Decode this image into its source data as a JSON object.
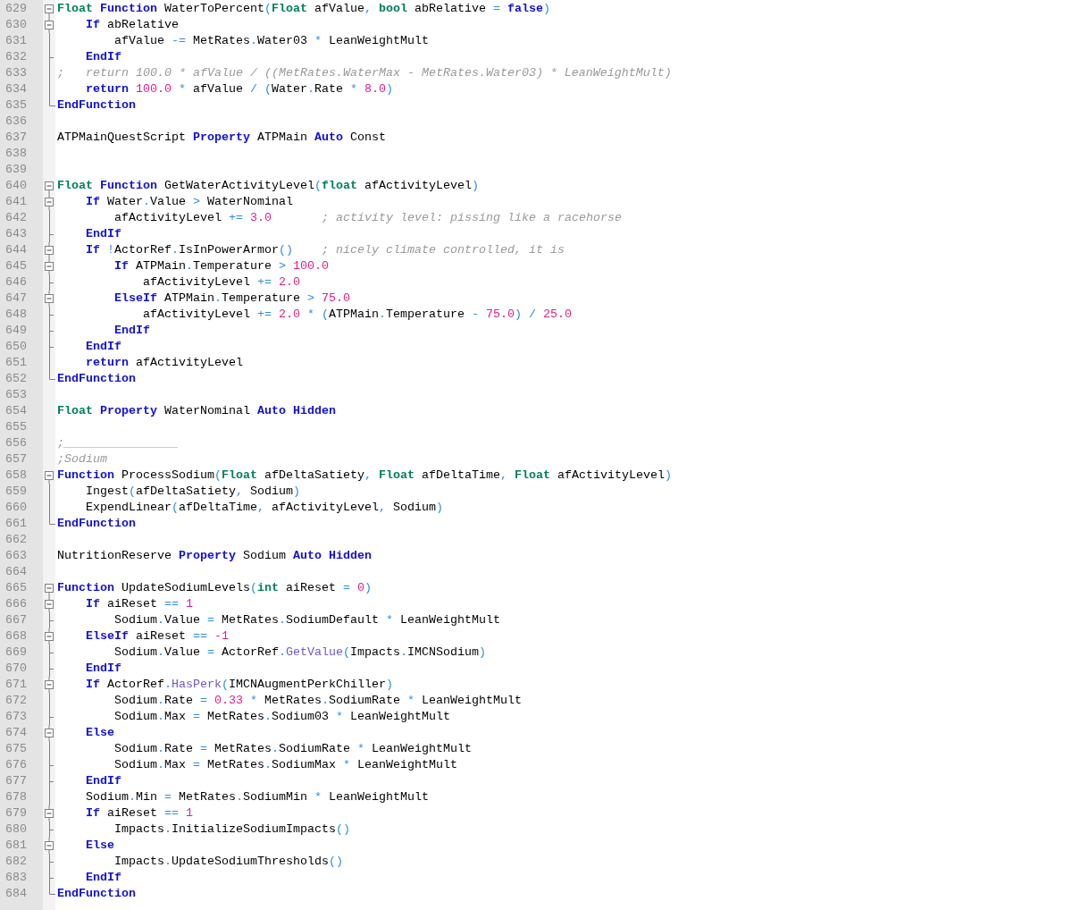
{
  "editor": {
    "lines": [
      {
        "number": "629",
        "fold": {
          "kind": "toggle"
        },
        "tokens": [
          {
            "kind": "type",
            "text": "Float"
          },
          {
            "kind": "keyword",
            "text": " Function"
          },
          {
            "kind": "plain",
            "text": " WaterToPercent"
          },
          {
            "kind": "operator",
            "text": "("
          },
          {
            "kind": "type",
            "text": "Float"
          },
          {
            "kind": "plain",
            "text": " afValue"
          },
          {
            "kind": "operator",
            "text": ","
          },
          {
            "kind": "type",
            "text": " bool"
          },
          {
            "kind": "plain",
            "text": " abRelative"
          },
          {
            "kind": "operator",
            "text": " ="
          },
          {
            "kind": "keyword",
            "text": " false"
          },
          {
            "kind": "operator",
            "text": ")"
          }
        ]
      },
      {
        "number": "630",
        "fold": {
          "kind": "inner-toggle"
        },
        "tokens": [
          {
            "kind": "keyword",
            "text": "    If"
          },
          {
            "kind": "plain",
            "text": " abRelative"
          }
        ]
      },
      {
        "number": "631",
        "fold": {
          "kind": "line"
        },
        "tokens": [
          {
            "kind": "plain",
            "text": "        afValue"
          },
          {
            "kind": "operator",
            "text": " -="
          },
          {
            "kind": "plain",
            "text": " MetRates"
          },
          {
            "kind": "operator",
            "text": "."
          },
          {
            "kind": "plain",
            "text": "Water03"
          },
          {
            "kind": "operator",
            "text": " *"
          },
          {
            "kind": "plain",
            "text": " LeanWeightMult"
          }
        ]
      },
      {
        "number": "632",
        "fold": {
          "kind": "tick"
        },
        "tokens": [
          {
            "kind": "keyword",
            "text": "    EndIf"
          }
        ]
      },
      {
        "number": "633",
        "fold": {
          "kind": "line"
        },
        "tokens": [
          {
            "kind": "comment",
            "text": ";   return 100.0 * afValue / ((MetRates.WaterMax - MetRates.Water03) * LeanWeightMult)"
          }
        ]
      },
      {
        "number": "634",
        "fold": {
          "kind": "line"
        },
        "tokens": [
          {
            "kind": "keyword",
            "text": "    return"
          },
          {
            "kind": "number",
            "text": " 100.0"
          },
          {
            "kind": "operator",
            "text": " *"
          },
          {
            "kind": "plain",
            "text": " afValue"
          },
          {
            "kind": "operator",
            "text": " /"
          },
          {
            "kind": "operator",
            "text": " ("
          },
          {
            "kind": "plain",
            "text": "Water"
          },
          {
            "kind": "operator",
            "text": "."
          },
          {
            "kind": "plain",
            "text": "Rate"
          },
          {
            "kind": "operator",
            "text": " *"
          },
          {
            "kind": "number",
            "text": " 8.0"
          },
          {
            "kind": "operator",
            "text": ")"
          }
        ]
      },
      {
        "number": "635",
        "fold": {
          "kind": "end"
        },
        "tokens": [
          {
            "kind": "keyword",
            "text": "EndFunction"
          }
        ]
      },
      {
        "number": "636"
      },
      {
        "number": "637",
        "tokens": [
          {
            "kind": "plain",
            "text": "ATPMainQuestScript"
          },
          {
            "kind": "keyword",
            "text": " Property"
          },
          {
            "kind": "plain",
            "text": " ATPMain"
          },
          {
            "kind": "keyword",
            "text": " Auto"
          },
          {
            "kind": "plain",
            "text": " Const"
          }
        ]
      },
      {
        "number": "638"
      },
      {
        "number": "639"
      },
      {
        "number": "640",
        "fold": {
          "kind": "toggle"
        },
        "tokens": [
          {
            "kind": "type",
            "text": "Float"
          },
          {
            "kind": "keyword",
            "text": " Function"
          },
          {
            "kind": "plain",
            "text": " GetWaterActivityLevel"
          },
          {
            "kind": "operator",
            "text": "("
          },
          {
            "kind": "type",
            "text": "float"
          },
          {
            "kind": "plain",
            "text": " afActivityLevel"
          },
          {
            "kind": "operator",
            "text": ")"
          }
        ]
      },
      {
        "number": "641",
        "fold": {
          "kind": "inner-toggle"
        },
        "tokens": [
          {
            "kind": "keyword",
            "text": "    If"
          },
          {
            "kind": "plain",
            "text": " Water"
          },
          {
            "kind": "operator",
            "text": "."
          },
          {
            "kind": "plain",
            "text": "Value"
          },
          {
            "kind": "operator",
            "text": " >"
          },
          {
            "kind": "plain",
            "text": " WaterNominal"
          }
        ]
      },
      {
        "number": "642",
        "fold": {
          "kind": "line"
        },
        "tokens": [
          {
            "kind": "plain",
            "text": "        afActivityLevel"
          },
          {
            "kind": "operator",
            "text": " +="
          },
          {
            "kind": "number",
            "text": " 3.0"
          },
          {
            "kind": "comment",
            "text": "       ; activity level: pissing like a racehorse"
          }
        ]
      },
      {
        "number": "643",
        "fold": {
          "kind": "tick"
        },
        "tokens": [
          {
            "kind": "keyword",
            "text": "    EndIf"
          }
        ]
      },
      {
        "number": "644",
        "fold": {
          "kind": "inner-toggle"
        },
        "tokens": [
          {
            "kind": "keyword",
            "text": "    If"
          },
          {
            "kind": "operator",
            "text": " !"
          },
          {
            "kind": "plain",
            "text": "ActorRef"
          },
          {
            "kind": "operator",
            "text": "."
          },
          {
            "kind": "plain",
            "text": "IsInPowerArmor"
          },
          {
            "kind": "operator",
            "text": "()"
          },
          {
            "kind": "comment",
            "text": "    ; nicely climate controlled, it is"
          }
        ]
      },
      {
        "number": "645",
        "fold": {
          "kind": "inner-toggle"
        },
        "tokens": [
          {
            "kind": "keyword",
            "text": "        If"
          },
          {
            "kind": "plain",
            "text": " ATPMain"
          },
          {
            "kind": "operator",
            "text": "."
          },
          {
            "kind": "plain",
            "text": "Temperature"
          },
          {
            "kind": "operator",
            "text": " >"
          },
          {
            "kind": "number",
            "text": " 100.0"
          }
        ]
      },
      {
        "number": "646",
        "fold": {
          "kind": "tick"
        },
        "tokens": [
          {
            "kind": "plain",
            "text": "            afActivityLevel"
          },
          {
            "kind": "operator",
            "text": " +="
          },
          {
            "kind": "number",
            "text": " 2.0"
          }
        ]
      },
      {
        "number": "647",
        "fold": {
          "kind": "inner-toggle"
        },
        "tokens": [
          {
            "kind": "keyword",
            "text": "        ElseIf"
          },
          {
            "kind": "plain",
            "text": " ATPMain"
          },
          {
            "kind": "operator",
            "text": "."
          },
          {
            "kind": "plain",
            "text": "Temperature"
          },
          {
            "kind": "operator",
            "text": " >"
          },
          {
            "kind": "number",
            "text": " 75.0"
          }
        ]
      },
      {
        "number": "648",
        "fold": {
          "kind": "tick"
        },
        "tokens": [
          {
            "kind": "plain",
            "text": "            afActivityLevel"
          },
          {
            "kind": "operator",
            "text": " +="
          },
          {
            "kind": "number",
            "text": " 2.0"
          },
          {
            "kind": "operator",
            "text": " *"
          },
          {
            "kind": "operator",
            "text": " ("
          },
          {
            "kind": "plain",
            "text": "ATPMain"
          },
          {
            "kind": "operator",
            "text": "."
          },
          {
            "kind": "plain",
            "text": "Temperature"
          },
          {
            "kind": "operator",
            "text": " -"
          },
          {
            "kind": "number",
            "text": " 75.0"
          },
          {
            "kind": "operator",
            "text": ")"
          },
          {
            "kind": "operator",
            "text": " /"
          },
          {
            "kind": "number",
            "text": " 25.0"
          }
        ]
      },
      {
        "number": "649",
        "fold": {
          "kind": "tick"
        },
        "tokens": [
          {
            "kind": "keyword",
            "text": "        EndIf"
          }
        ]
      },
      {
        "number": "650",
        "fold": {
          "kind": "tick"
        },
        "tokens": [
          {
            "kind": "keyword",
            "text": "    EndIf"
          }
        ]
      },
      {
        "number": "651",
        "fold": {
          "kind": "line"
        },
        "tokens": [
          {
            "kind": "keyword",
            "text": "    return"
          },
          {
            "kind": "plain",
            "text": " afActivityLevel"
          }
        ]
      },
      {
        "number": "652",
        "fold": {
          "kind": "end"
        },
        "tokens": [
          {
            "kind": "keyword",
            "text": "EndFunction"
          }
        ]
      },
      {
        "number": "653"
      },
      {
        "number": "654",
        "tokens": [
          {
            "kind": "type",
            "text": "Float"
          },
          {
            "kind": "keyword",
            "text": " Property"
          },
          {
            "kind": "plain",
            "text": " WaterNominal"
          },
          {
            "kind": "keyword",
            "text": " Auto"
          },
          {
            "kind": "keyword",
            "text": " Hidden"
          }
        ]
      },
      {
        "number": "655"
      },
      {
        "number": "656",
        "tokens": [
          {
            "kind": "comment",
            "text": ";________________"
          }
        ]
      },
      {
        "number": "657",
        "tokens": [
          {
            "kind": "comment",
            "text": ";Sodium"
          }
        ]
      },
      {
        "number": "658",
        "fold": {
          "kind": "toggle"
        },
        "tokens": [
          {
            "kind": "keyword",
            "text": "Function"
          },
          {
            "kind": "plain",
            "text": " ProcessSodium"
          },
          {
            "kind": "operator",
            "text": "("
          },
          {
            "kind": "type",
            "text": "Float"
          },
          {
            "kind": "plain",
            "text": " afDeltaSatiety"
          },
          {
            "kind": "operator",
            "text": ","
          },
          {
            "kind": "type",
            "text": " Float"
          },
          {
            "kind": "plain",
            "text": " afDeltaTime"
          },
          {
            "kind": "operator",
            "text": ","
          },
          {
            "kind": "type",
            "text": " Float"
          },
          {
            "kind": "plain",
            "text": " afActivityLevel"
          },
          {
            "kind": "operator",
            "text": ")"
          }
        ]
      },
      {
        "number": "659",
        "fold": {
          "kind": "line"
        },
        "tokens": [
          {
            "kind": "plain",
            "text": "    Ingest"
          },
          {
            "kind": "operator",
            "text": "("
          },
          {
            "kind": "plain",
            "text": "afDeltaSatiety"
          },
          {
            "kind": "operator",
            "text": ","
          },
          {
            "kind": "plain",
            "text": " Sodium"
          },
          {
            "kind": "operator",
            "text": ")"
          }
        ]
      },
      {
        "number": "660",
        "fold": {
          "kind": "line"
        },
        "tokens": [
          {
            "kind": "plain",
            "text": "    ExpendLinear"
          },
          {
            "kind": "operator",
            "text": "("
          },
          {
            "kind": "plain",
            "text": "afDeltaTime"
          },
          {
            "kind": "operator",
            "text": ","
          },
          {
            "kind": "plain",
            "text": " afActivityLevel"
          },
          {
            "kind": "operator",
            "text": ","
          },
          {
            "kind": "plain",
            "text": " Sodium"
          },
          {
            "kind": "operator",
            "text": ")"
          }
        ]
      },
      {
        "number": "661",
        "fold": {
          "kind": "end"
        },
        "tokens": [
          {
            "kind": "keyword",
            "text": "EndFunction"
          }
        ]
      },
      {
        "number": "662"
      },
      {
        "number": "663",
        "tokens": [
          {
            "kind": "plain",
            "text": "NutritionReserve"
          },
          {
            "kind": "keyword",
            "text": " Property"
          },
          {
            "kind": "plain",
            "text": " Sodium"
          },
          {
            "kind": "keyword",
            "text": " Auto"
          },
          {
            "kind": "keyword",
            "text": " Hidden"
          }
        ]
      },
      {
        "number": "664"
      },
      {
        "number": "665",
        "fold": {
          "kind": "toggle"
        },
        "tokens": [
          {
            "kind": "keyword",
            "text": "Function"
          },
          {
            "kind": "plain",
            "text": " UpdateSodiumLevels"
          },
          {
            "kind": "operator",
            "text": "("
          },
          {
            "kind": "type",
            "text": "int"
          },
          {
            "kind": "plain",
            "text": " aiReset"
          },
          {
            "kind": "operator",
            "text": " ="
          },
          {
            "kind": "number",
            "text": " 0"
          },
          {
            "kind": "operator",
            "text": ")"
          }
        ]
      },
      {
        "number": "666",
        "fold": {
          "kind": "inner-toggle"
        },
        "tokens": [
          {
            "kind": "keyword",
            "text": "    If"
          },
          {
            "kind": "plain",
            "text": " aiReset"
          },
          {
            "kind": "operator",
            "text": " =="
          },
          {
            "kind": "number",
            "text": " 1"
          }
        ]
      },
      {
        "number": "667",
        "fold": {
          "kind": "tick"
        },
        "tokens": [
          {
            "kind": "plain",
            "text": "        Sodium"
          },
          {
            "kind": "operator",
            "text": "."
          },
          {
            "kind": "plain",
            "text": "Value"
          },
          {
            "kind": "operator",
            "text": " ="
          },
          {
            "kind": "plain",
            "text": " MetRates"
          },
          {
            "kind": "operator",
            "text": "."
          },
          {
            "kind": "plain",
            "text": "SodiumDefault"
          },
          {
            "kind": "operator",
            "text": " *"
          },
          {
            "kind": "plain",
            "text": " LeanWeightMult"
          }
        ]
      },
      {
        "number": "668",
        "fold": {
          "kind": "inner-toggle"
        },
        "tokens": [
          {
            "kind": "keyword",
            "text": "    ElseIf"
          },
          {
            "kind": "plain",
            "text": " aiReset"
          },
          {
            "kind": "operator",
            "text": " =="
          },
          {
            "kind": "number",
            "text": " -1"
          }
        ]
      },
      {
        "number": "669",
        "fold": {
          "kind": "tick"
        },
        "tokens": [
          {
            "kind": "plain",
            "text": "        Sodium"
          },
          {
            "kind": "operator",
            "text": "."
          },
          {
            "kind": "plain",
            "text": "Value"
          },
          {
            "kind": "operator",
            "text": " ="
          },
          {
            "kind": "plain",
            "text": " ActorRef"
          },
          {
            "kind": "operator",
            "text": "."
          },
          {
            "kind": "function",
            "text": "GetValue"
          },
          {
            "kind": "operator",
            "text": "("
          },
          {
            "kind": "plain",
            "text": "Impacts"
          },
          {
            "kind": "operator",
            "text": "."
          },
          {
            "kind": "plain",
            "text": "IMCNSodium"
          },
          {
            "kind": "operator",
            "text": ")"
          }
        ]
      },
      {
        "number": "670",
        "fold": {
          "kind": "tick"
        },
        "tokens": [
          {
            "kind": "keyword",
            "text": "    EndIf"
          }
        ]
      },
      {
        "number": "671",
        "fold": {
          "kind": "inner-toggle"
        },
        "tokens": [
          {
            "kind": "keyword",
            "text": "    If"
          },
          {
            "kind": "plain",
            "text": " ActorRef"
          },
          {
            "kind": "operator",
            "text": "."
          },
          {
            "kind": "function",
            "text": "HasPerk"
          },
          {
            "kind": "operator",
            "text": "("
          },
          {
            "kind": "plain",
            "text": "IMCNAugmentPerkChiller"
          },
          {
            "kind": "operator",
            "text": ")"
          }
        ]
      },
      {
        "number": "672",
        "fold": {
          "kind": "line"
        },
        "tokens": [
          {
            "kind": "plain",
            "text": "        Sodium"
          },
          {
            "kind": "operator",
            "text": "."
          },
          {
            "kind": "plain",
            "text": "Rate"
          },
          {
            "kind": "operator",
            "text": " ="
          },
          {
            "kind": "number",
            "text": " 0.33"
          },
          {
            "kind": "operator",
            "text": " *"
          },
          {
            "kind": "plain",
            "text": " MetRates"
          },
          {
            "kind": "operator",
            "text": "."
          },
          {
            "kind": "plain",
            "text": "SodiumRate"
          },
          {
            "kind": "operator",
            "text": " *"
          },
          {
            "kind": "plain",
            "text": " LeanWeightMult"
          }
        ]
      },
      {
        "number": "673",
        "fold": {
          "kind": "tick"
        },
        "tokens": [
          {
            "kind": "plain",
            "text": "        Sodium"
          },
          {
            "kind": "operator",
            "text": "."
          },
          {
            "kind": "plain",
            "text": "Max"
          },
          {
            "kind": "operator",
            "text": " ="
          },
          {
            "kind": "plain",
            "text": " MetRates"
          },
          {
            "kind": "operator",
            "text": "."
          },
          {
            "kind": "plain",
            "text": "Sodium03"
          },
          {
            "kind": "operator",
            "text": " *"
          },
          {
            "kind": "plain",
            "text": " LeanWeightMult"
          }
        ]
      },
      {
        "number": "674",
        "fold": {
          "kind": "inner-toggle"
        },
        "tokens": [
          {
            "kind": "keyword",
            "text": "    Else"
          }
        ]
      },
      {
        "number": "675",
        "fold": {
          "kind": "line"
        },
        "tokens": [
          {
            "kind": "plain",
            "text": "        Sodium"
          },
          {
            "kind": "operator",
            "text": "."
          },
          {
            "kind": "plain",
            "text": "Rate"
          },
          {
            "kind": "operator",
            "text": " ="
          },
          {
            "kind": "plain",
            "text": " MetRates"
          },
          {
            "kind": "operator",
            "text": "."
          },
          {
            "kind": "plain",
            "text": "SodiumRate"
          },
          {
            "kind": "operator",
            "text": " *"
          },
          {
            "kind": "plain",
            "text": " LeanWeightMult"
          }
        ]
      },
      {
        "number": "676",
        "fold": {
          "kind": "tick"
        },
        "tokens": [
          {
            "kind": "plain",
            "text": "        Sodium"
          },
          {
            "kind": "operator",
            "text": "."
          },
          {
            "kind": "plain",
            "text": "Max"
          },
          {
            "kind": "operator",
            "text": " ="
          },
          {
            "kind": "plain",
            "text": " MetRates"
          },
          {
            "kind": "operator",
            "text": "."
          },
          {
            "kind": "plain",
            "text": "SodiumMax"
          },
          {
            "kind": "operator",
            "text": " *"
          },
          {
            "kind": "plain",
            "text": " LeanWeightMult"
          }
        ]
      },
      {
        "number": "677",
        "fold": {
          "kind": "tick"
        },
        "tokens": [
          {
            "kind": "keyword",
            "text": "    EndIf"
          }
        ]
      },
      {
        "number": "678",
        "fold": {
          "kind": "line"
        },
        "tokens": [
          {
            "kind": "plain",
            "text": "    Sodium"
          },
          {
            "kind": "operator",
            "text": "."
          },
          {
            "kind": "plain",
            "text": "Min"
          },
          {
            "kind": "operator",
            "text": " ="
          },
          {
            "kind": "plain",
            "text": " MetRates"
          },
          {
            "kind": "operator",
            "text": "."
          },
          {
            "kind": "plain",
            "text": "SodiumMin"
          },
          {
            "kind": "operator",
            "text": " *"
          },
          {
            "kind": "plain",
            "text": " LeanWeightMult"
          }
        ]
      },
      {
        "number": "679",
        "fold": {
          "kind": "inner-toggle"
        },
        "tokens": [
          {
            "kind": "keyword",
            "text": "    If"
          },
          {
            "kind": "plain",
            "text": " aiReset"
          },
          {
            "kind": "operator",
            "text": " =="
          },
          {
            "kind": "number",
            "text": " 1"
          }
        ]
      },
      {
        "number": "680",
        "fold": {
          "kind": "tick"
        },
        "tokens": [
          {
            "kind": "plain",
            "text": "        Impacts"
          },
          {
            "kind": "operator",
            "text": "."
          },
          {
            "kind": "plain",
            "text": "InitializeSodiumImpacts"
          },
          {
            "kind": "operator",
            "text": "()"
          }
        ]
      },
      {
        "number": "681",
        "fold": {
          "kind": "inner-toggle"
        },
        "tokens": [
          {
            "kind": "keyword",
            "text": "    Else"
          }
        ]
      },
      {
        "number": "682",
        "fold": {
          "kind": "tick"
        },
        "tokens": [
          {
            "kind": "plain",
            "text": "        Impacts"
          },
          {
            "kind": "operator",
            "text": "."
          },
          {
            "kind": "plain",
            "text": "UpdateSodiumThresholds"
          },
          {
            "kind": "operator",
            "text": "()"
          }
        ]
      },
      {
        "number": "683",
        "fold": {
          "kind": "tick"
        },
        "tokens": [
          {
            "kind": "keyword",
            "text": "    EndIf"
          }
        ]
      },
      {
        "number": "684",
        "fold": {
          "kind": "end"
        },
        "tokens": [
          {
            "kind": "keyword",
            "text": "EndFunction"
          }
        ]
      }
    ]
  }
}
